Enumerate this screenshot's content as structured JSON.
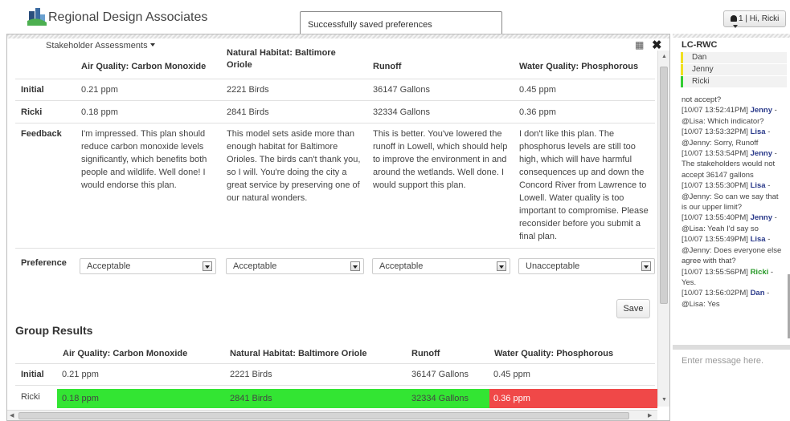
{
  "header": {
    "brand": "Regional Design Associates",
    "toast": "Successfully saved preferences",
    "user_label": "1 | Hi, Ricki"
  },
  "panel": {
    "title": "Stakeholder Assessments",
    "close_glyph": "✖",
    "columns": [
      "Air Quality: Carbon Monoxide",
      "Natural Habitat: Baltimore Oriole",
      "Runoff",
      "Water Quality: Phosphorous"
    ],
    "rows": {
      "initial": {
        "label": "Initial",
        "values": [
          "0.21 ppm",
          "2221 Birds",
          "36147 Gallons",
          "0.45 ppm"
        ]
      },
      "ricki": {
        "label": "Ricki",
        "values": [
          "0.18 ppm",
          "2841 Birds",
          "32334 Gallons",
          "0.36 ppm"
        ]
      },
      "feedback": {
        "label": "Feedback",
        "values": [
          "I'm impressed. This plan should reduce carbon monoxide levels significantly, which benefits both people and wildlife.  Well done! I would endorse this plan.",
          "This model sets aside more than enough habitat for Baltimore Orioles. The birds can't thank you, so I will. You're doing the city a great service by preserving one of our natural wonders.",
          "This is better. You've lowered the runoff in Lowell, which should help to improve the environment in and around the wetlands. Well done. I would support this plan.",
          "I don't like this plan. The phosphorus levels are still too high, which will have harmful consequences up and down the Concord River from Lawrence to Lowell. Water quality is too important to compromise. Please reconsider before you submit a final plan."
        ]
      },
      "preference": {
        "label": "Preference",
        "values": [
          "Acceptable",
          "Acceptable",
          "Acceptable",
          "Unacceptable"
        ]
      }
    },
    "save_label": "Save",
    "group": {
      "title": "Group Results",
      "columns": [
        "Air Quality: Carbon Monoxide",
        "Natural Habitat: Baltimore Oriole",
        "Runoff",
        "Water Quality: Phosphorous"
      ],
      "initial": {
        "label": "Initial",
        "values": [
          "0.21 ppm",
          "2221 Birds",
          "36147 Gallons",
          "0.45 ppm"
        ]
      },
      "ricki": {
        "label": "Ricki",
        "values": [
          "0.18 ppm",
          "2841 Birds",
          "32334 Gallons",
          "0.36 ppm"
        ]
      }
    },
    "status_colors": {
      "acceptable": "#33e533",
      "unacceptable": "#f04848"
    }
  },
  "chat": {
    "title": "LC-RWC",
    "members": [
      "Dan",
      "Jenny",
      "Ricki"
    ],
    "messages": [
      {
        "prefix": "",
        "name": "",
        "text": "not accept?"
      },
      {
        "prefix": "[10/07 13:52:41PM] ",
        "name": "Jenny",
        "text": " - @Lisa: Which indicator?"
      },
      {
        "prefix": "[10/07 13:53:32PM] ",
        "name": "Lisa",
        "text": " - @Jenny: Sorry, Runoff"
      },
      {
        "prefix": "[10/07 13:53:54PM] ",
        "name": "Jenny",
        "text": " - The stakeholders would not accept 36147 gallons"
      },
      {
        "prefix": "[10/07 13:55:30PM] ",
        "name": "Lisa",
        "text": " - @Jenny: So can we say that is our upper limit?"
      },
      {
        "prefix": "[10/07 13:55:40PM] ",
        "name": "Jenny",
        "text": " - @Lisa: Yeah I'd say so"
      },
      {
        "prefix": "[10/07 13:55:49PM] ",
        "name": "Lisa",
        "text": " - @Jenny: Does everyone else agree with that?"
      },
      {
        "prefix": "[10/07 13:55:56PM] ",
        "name": "Ricki",
        "text": " - Yes."
      },
      {
        "prefix": "[10/07 13:56:02PM] ",
        "name": "Dan",
        "text": " - @Lisa: Yes"
      }
    ],
    "input_placeholder": "Enter message here."
  }
}
